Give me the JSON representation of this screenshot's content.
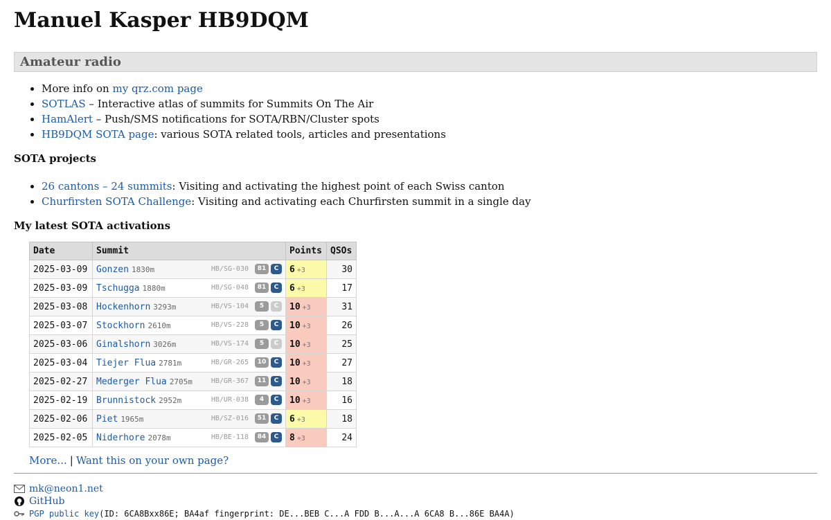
{
  "title": "Manuel Kasper HB9DQM",
  "section": "Amateur radio",
  "intro_items": [
    {
      "prefix": "More info on ",
      "link": "my qrz.com page",
      "suffix": ""
    },
    {
      "prefix": "",
      "link": "SOTLAS",
      "suffix": " – Interactive atlas of summits for Summits On The Air"
    },
    {
      "prefix": "",
      "link": "HamAlert",
      "suffix": " – Push/SMS notifications for SOTA/RBN/Cluster spots"
    },
    {
      "prefix": "",
      "link": "HB9DQM SOTA page",
      "suffix": ": various SOTA related tools, articles and presentations"
    }
  ],
  "projects_heading": "SOTA projects",
  "projects": [
    {
      "link": "26 cantons – 24 summits",
      "suffix": ": Visiting and activating the highest point of each Swiss canton"
    },
    {
      "link": "Churfirsten SOTA Challenge",
      "suffix": ": Visiting and activating each Churfirsten summit in a single day"
    }
  ],
  "activations_heading": "My latest SOTA activations",
  "table": {
    "headers": {
      "date": "Date",
      "summit": "Summit",
      "points": "Points",
      "qsos": "QSOs"
    },
    "rows": [
      {
        "date": "2025-03-09",
        "name": "Gonzen",
        "alt": "1830m",
        "ref": "HB/SG-030",
        "count": "81",
        "c": "C",
        "c_active": true,
        "points": "6",
        "bonus": "+3",
        "color": "yellow",
        "qsos": "30"
      },
      {
        "date": "2025-03-09",
        "name": "Tschugga",
        "alt": "1880m",
        "ref": "HB/SG-048",
        "count": "81",
        "c": "C",
        "c_active": true,
        "points": "6",
        "bonus": "+3",
        "color": "yellow",
        "qsos": "17"
      },
      {
        "date": "2025-03-08",
        "name": "Hockenhorn",
        "alt": "3293m",
        "ref": "HB/VS-104",
        "count": "5",
        "c": "C",
        "c_active": false,
        "points": "10",
        "bonus": "+3",
        "color": "red",
        "qsos": "31"
      },
      {
        "date": "2025-03-07",
        "name": "Stockhorn",
        "alt": "2610m",
        "ref": "HB/VS-228",
        "count": "5",
        "c": "C",
        "c_active": true,
        "points": "10",
        "bonus": "+3",
        "color": "red",
        "qsos": "26"
      },
      {
        "date": "2025-03-06",
        "name": "Ginalshorn",
        "alt": "3026m",
        "ref": "HB/VS-174",
        "count": "5",
        "c": "C",
        "c_active": false,
        "points": "10",
        "bonus": "+3",
        "color": "red",
        "qsos": "25"
      },
      {
        "date": "2025-03-04",
        "name": "Tiejer Flua",
        "alt": "2781m",
        "ref": "HB/GR-265",
        "count": "10",
        "c": "C",
        "c_active": true,
        "points": "10",
        "bonus": "+3",
        "color": "red",
        "qsos": "27"
      },
      {
        "date": "2025-02-27",
        "name": "Mederger Flua",
        "alt": "2705m",
        "ref": "HB/GR-367",
        "count": "11",
        "c": "C",
        "c_active": true,
        "points": "10",
        "bonus": "+3",
        "color": "red",
        "qsos": "18"
      },
      {
        "date": "2025-02-19",
        "name": "Brunnistock",
        "alt": "2952m",
        "ref": "HB/UR-038",
        "count": "4",
        "c": "C",
        "c_active": true,
        "points": "10",
        "bonus": "+3",
        "color": "red",
        "qsos": "16"
      },
      {
        "date": "2025-02-06",
        "name": "Piet",
        "alt": "1965m",
        "ref": "HB/SZ-016",
        "count": "51",
        "c": "C",
        "c_active": true,
        "points": "6",
        "bonus": "+3",
        "color": "yellow",
        "qsos": "18"
      },
      {
        "date": "2025-02-05",
        "name": "Niderhore",
        "alt": "2078m",
        "ref": "HB/BE-118",
        "count": "84",
        "c": "C",
        "c_active": true,
        "points": "8",
        "bonus": "+3",
        "color": "red",
        "qsos": "24"
      }
    ]
  },
  "more_link": "More...",
  "more_sep": "|",
  "own_page_link": "Want this on your own page?",
  "footer": {
    "email": "mk@neon1.net",
    "github": "GitHub",
    "pgp_link": "PGP public key",
    "pgp_text": " (ID: 6CA8Bxx86E; BA4af fingerprint: DE...BEB C...A FDD B...A...A 6CA8 B...86E BA4A)"
  }
}
